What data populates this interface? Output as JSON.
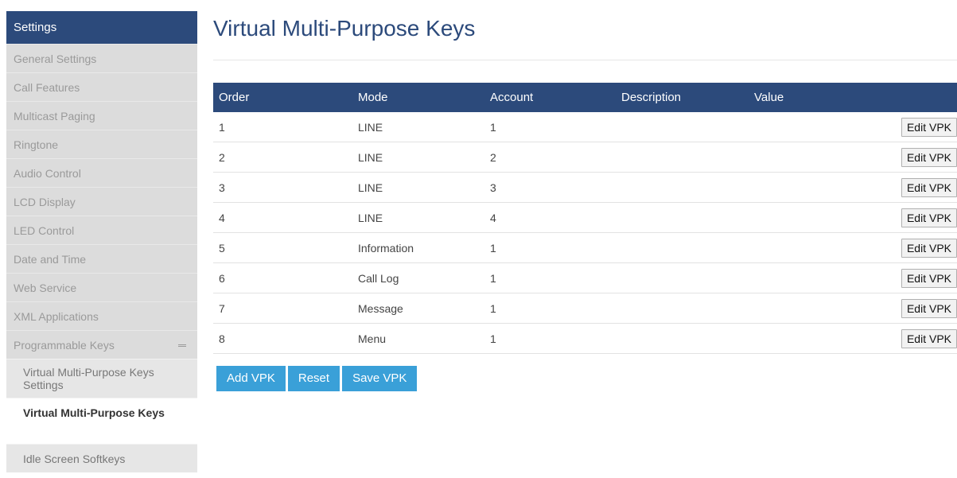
{
  "sidebar": {
    "header": "Settings",
    "items": [
      "General Settings",
      "Call Features",
      "Multicast Paging",
      "Ringtone",
      "Audio Control",
      "LCD Display",
      "LED Control",
      "Date and Time",
      "Web Service",
      "XML Applications",
      "Programmable Keys"
    ],
    "sub_items": [
      "Virtual Multi-Purpose Keys Settings",
      "Virtual Multi-Purpose Keys",
      "Idle Screen Softkeys"
    ],
    "active_sub_item": "Virtual Multi-Purpose Keys"
  },
  "page": {
    "title": "Virtual Multi-Purpose Keys"
  },
  "table": {
    "headers": [
      "Order",
      "Mode",
      "Account",
      "Description",
      "Value",
      ""
    ],
    "rows": [
      {
        "order": "1",
        "mode": "LINE",
        "account": "1",
        "description": "",
        "value": "",
        "action": "Edit VPK"
      },
      {
        "order": "2",
        "mode": "LINE",
        "account": "2",
        "description": "",
        "value": "",
        "action": "Edit VPK"
      },
      {
        "order": "3",
        "mode": "LINE",
        "account": "3",
        "description": "",
        "value": "",
        "action": "Edit VPK"
      },
      {
        "order": "4",
        "mode": "LINE",
        "account": "4",
        "description": "",
        "value": "",
        "action": "Edit VPK"
      },
      {
        "order": "5",
        "mode": "Information",
        "account": "1",
        "description": "",
        "value": "",
        "action": "Edit VPK"
      },
      {
        "order": "6",
        "mode": "Call Log",
        "account": "1",
        "description": "",
        "value": "",
        "action": "Edit VPK"
      },
      {
        "order": "7",
        "mode": "Message",
        "account": "1",
        "description": "",
        "value": "",
        "action": "Edit VPK"
      },
      {
        "order": "8",
        "mode": "Menu",
        "account": "1",
        "description": "",
        "value": "",
        "action": "Edit VPK"
      }
    ]
  },
  "actions": {
    "add": "Add VPK",
    "reset": "Reset",
    "save": "Save VPK"
  },
  "colors": {
    "header_blue": "#2c4a7b",
    "button_blue": "#3aa0d8",
    "sidebar_gray": "#dcdcdc"
  }
}
